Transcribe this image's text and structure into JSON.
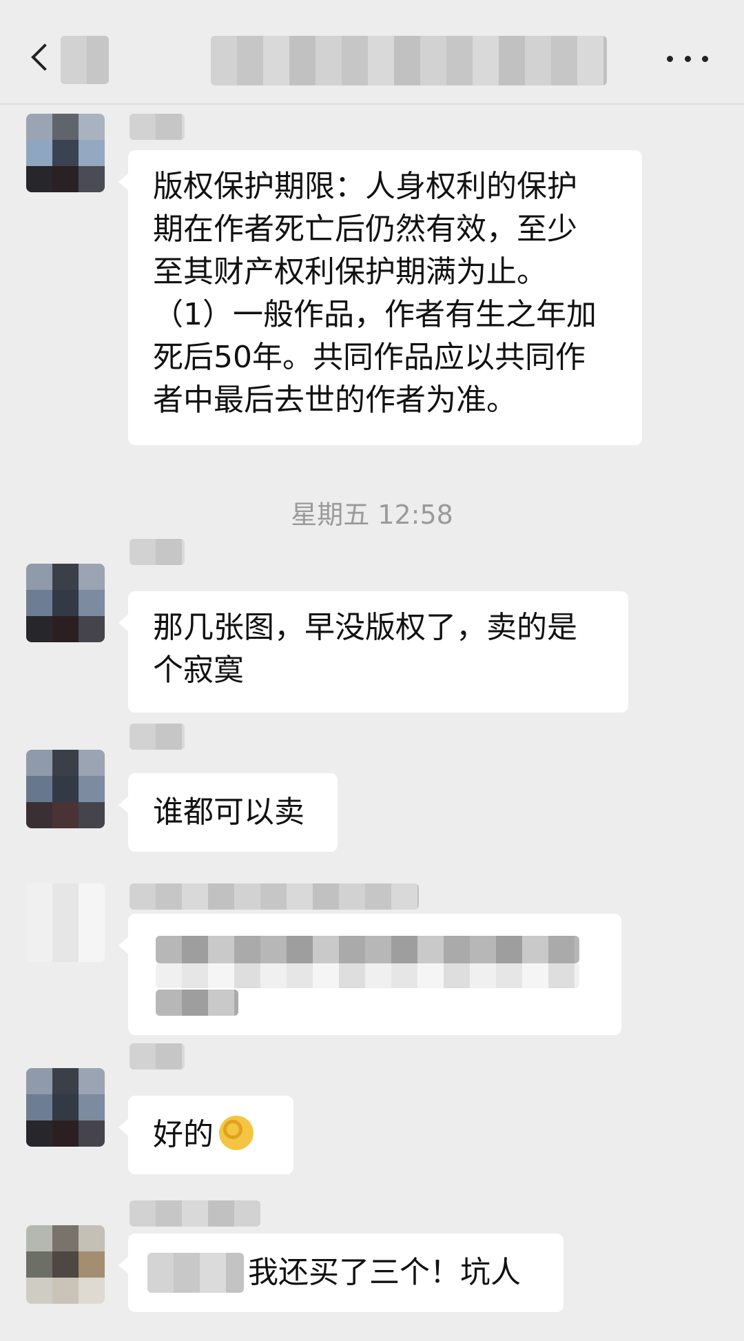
{
  "header": {
    "back_icon": "chevron-left-icon",
    "more_icon": "ellipsis-icon"
  },
  "timestamp": "星期五 12:58",
  "messages": [
    {
      "lines": [
        "版权保护期限：人身权利的保护",
        "期在作者死亡后仍然有效，至少",
        "至其财产权利保护期满为止。",
        "（1）一般作品，作者有生之年加",
        "死后50年。共同作品应以共同作",
        "者中最后去世的作者为准。"
      ]
    },
    {
      "lines": [
        "那几张图，早没版权了，卖的是",
        "个寂寞"
      ]
    },
    {
      "lines": [
        "谁都可以卖"
      ]
    },
    {
      "text": "好的",
      "emoji": "ok-hand-emoji"
    },
    {
      "text": "我还买了三个！坑人"
    }
  ]
}
